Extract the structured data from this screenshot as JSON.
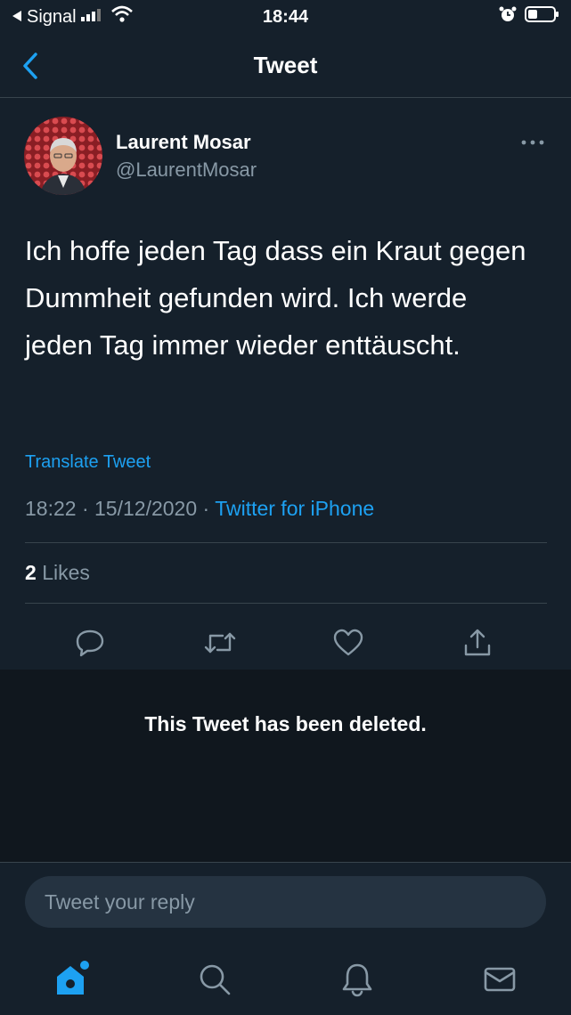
{
  "status_bar": {
    "carrier": "Signal",
    "time": "18:44"
  },
  "nav": {
    "title": "Tweet"
  },
  "tweet": {
    "author_name": "Laurent Mosar",
    "author_handle": "@LaurentMosar",
    "text": "Ich hoffe jeden Tag dass ein Kraut gegen Dummheit gefunden wird. Ich werde jeden Tag immer wieder enttäuscht.",
    "translate_label": "Translate Tweet",
    "time": "18:22",
    "date": "15/12/2020",
    "separator": "·",
    "source": "Twitter for iPhone",
    "likes_count": "2",
    "likes_label": "Likes"
  },
  "deleted_notice": "This Tweet has been deleted.",
  "reply": {
    "placeholder": "Tweet your reply"
  },
  "colors": {
    "background": "#15202b",
    "accent": "#1da1f2",
    "secondary_text": "#8899a6"
  },
  "icons": {
    "actions": [
      "reply-icon",
      "retweet-icon",
      "like-icon",
      "share-icon"
    ],
    "tabs": [
      "home-icon",
      "search-icon",
      "notifications-icon",
      "messages-icon"
    ]
  }
}
